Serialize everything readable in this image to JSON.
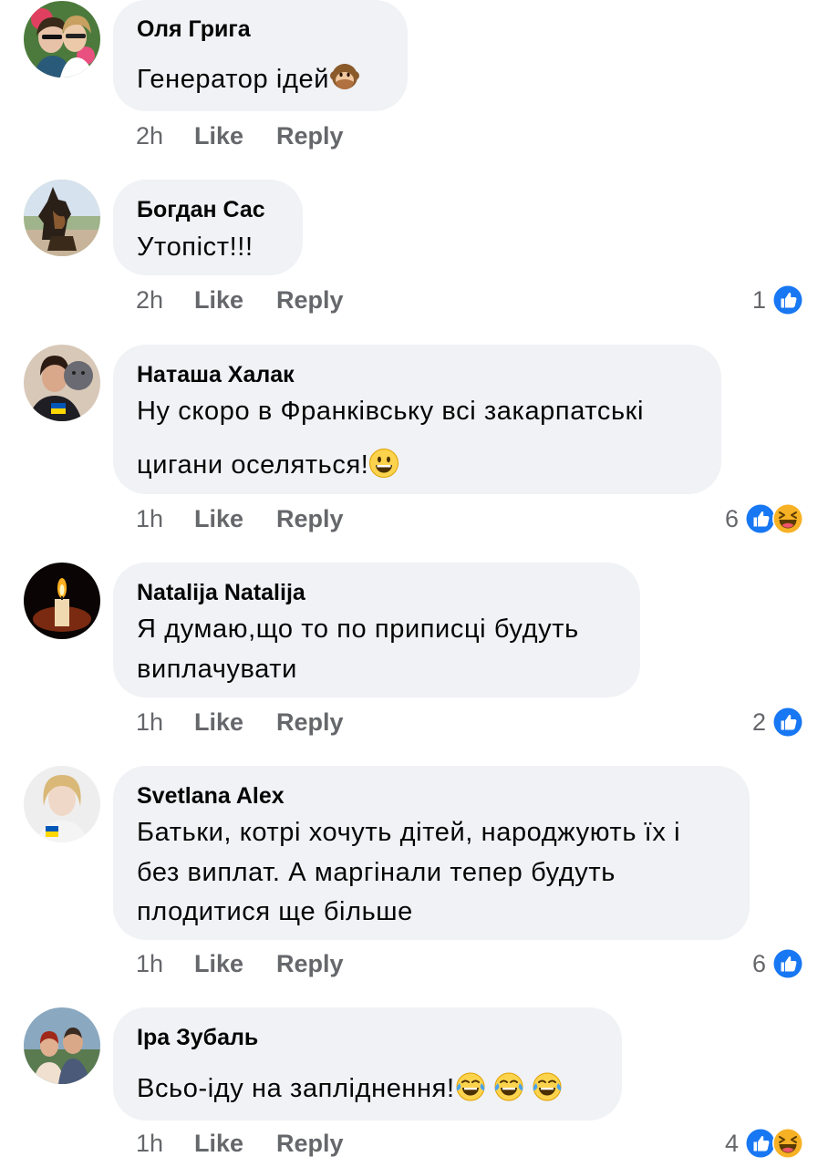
{
  "comments": [
    {
      "author": "Оля Грига",
      "text_lines": [
        "Генератор ідей"
      ],
      "time": "2h",
      "like_label": "Like",
      "reply_label": "Reply",
      "reaction_count": "",
      "emoji": "see-no-evil-monkey"
    },
    {
      "author": "Богдан Сас",
      "text_lines": [
        "Утопіст!!!"
      ],
      "time": "2h",
      "like_label": "Like",
      "reply_label": "Reply",
      "reaction_count": "1",
      "reactions": [
        "like"
      ]
    },
    {
      "author": "Наташа Халак",
      "text_lines": [
        "Ну скоро в Франківську всі закарпатські",
        "цигани оселяться!"
      ],
      "time": "1h",
      "like_label": "Like",
      "reply_label": "Reply",
      "reaction_count": "6",
      "reactions": [
        "like",
        "haha"
      ],
      "emoji": "grinning-face"
    },
    {
      "author": "Natalija Natalija",
      "text_lines": [
        "Я думаю,що то по приписці будуть",
        "виплачувати"
      ],
      "time": "1h",
      "like_label": "Like",
      "reply_label": "Reply",
      "reaction_count": "2",
      "reactions": [
        "like"
      ]
    },
    {
      "author": "Svetlana Alex",
      "text_lines": [
        "Батьки, котрі хочуть дітей, народжують їх і",
        "без виплат. А маргінали тепер будуть",
        "плодитися ще більше"
      ],
      "time": "1h",
      "like_label": "Like",
      "reply_label": "Reply",
      "reaction_count": "6",
      "reactions": [
        "like"
      ]
    },
    {
      "author": "Іра Зубаль",
      "text_lines": [
        "Всьо-іду на запліднення!"
      ],
      "time": "1h",
      "like_label": "Like",
      "reply_label": "Reply",
      "reaction_count": "4",
      "reactions": [
        "like",
        "haha"
      ],
      "emoji": "tears-of-joy x3"
    }
  ],
  "colors": {
    "bubble": "#f0f2f5",
    "meta_text": "#65676b",
    "like_blue": "#1877f2",
    "haha_yellow": "#f7b125"
  }
}
